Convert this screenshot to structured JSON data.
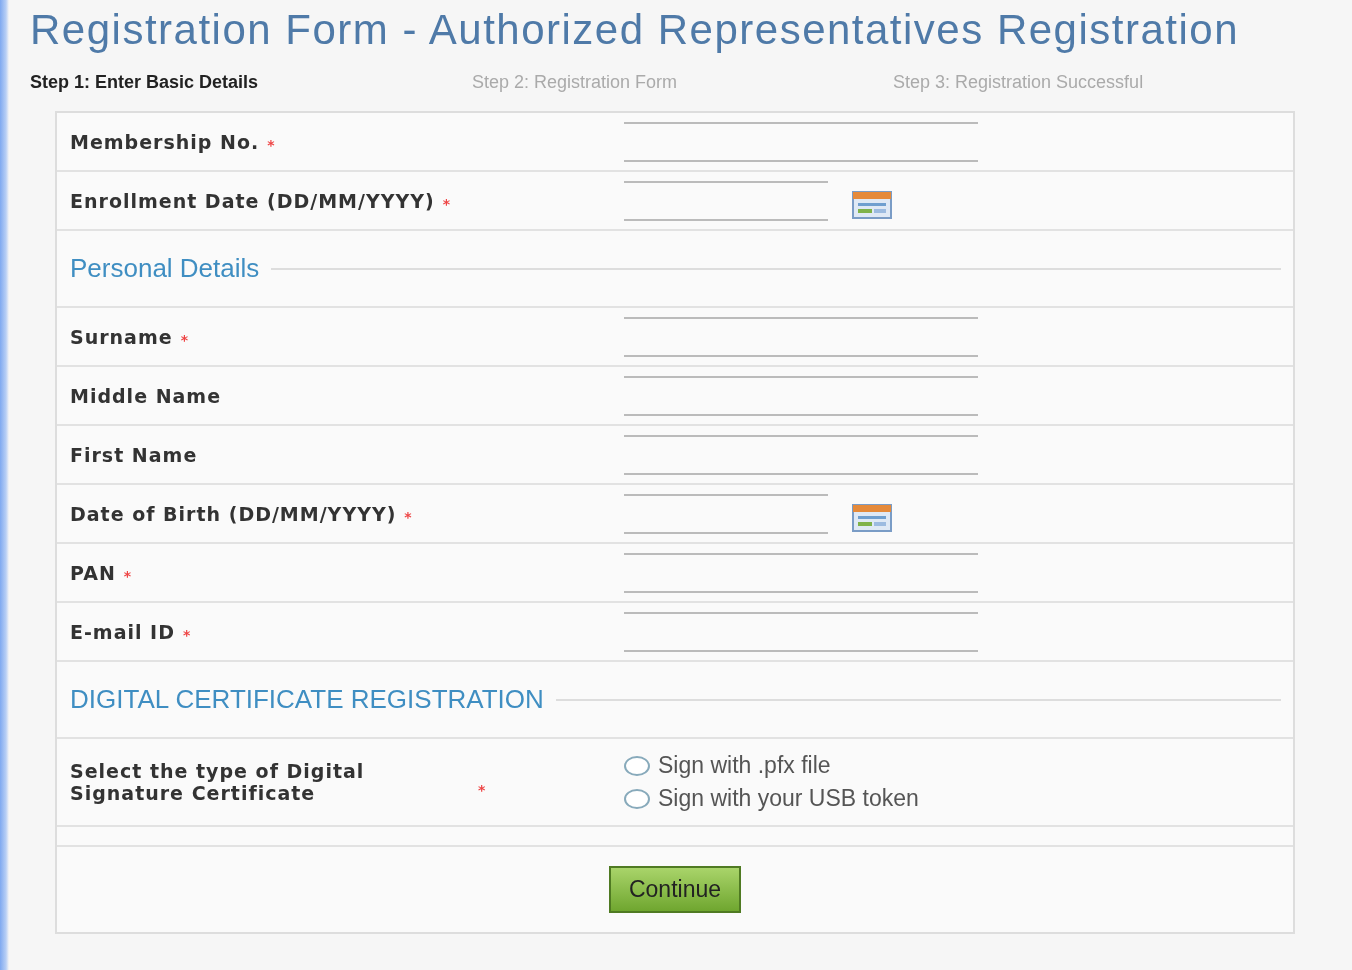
{
  "title": "Registration Form - Authorized Representatives Registration",
  "steps": [
    {
      "label": "Step 1: Enter Basic Details",
      "selected": true
    },
    {
      "label": "Step 2: Registration Form",
      "selected": false
    },
    {
      "label": "Step 3: Registration Successful",
      "selected": false
    }
  ],
  "rows": [
    {
      "kind": "field",
      "label": "Membership No.",
      "mark": "*"
    },
    {
      "kind": "date",
      "label": "Enrollment Date (DD/MM/YYYY)",
      "mark": "*"
    },
    {
      "kind": "section",
      "label": "Personal Details"
    },
    {
      "kind": "field",
      "label": "Surname",
      "mark": "*"
    },
    {
      "kind": "field",
      "label": "Middle Name"
    },
    {
      "kind": "field",
      "label": "First Name"
    },
    {
      "kind": "date",
      "label": "Date of Birth (DD/MM/YYYY)",
      "mark": "*"
    },
    {
      "kind": "field",
      "label": "PAN",
      "mark": "*"
    },
    {
      "kind": "field",
      "label": "E-mail ID",
      "mark": "*"
    },
    {
      "kind": "section",
      "label": "DIGITAL CERTIFICATE REGISTRATION"
    },
    {
      "kind": "radio",
      "label": "Select the type of Digital Signature Certificate",
      "mark": "*",
      "options": [
        {
          "label": "Sign with .pfx file",
          "selected": false
        },
        {
          "label": "Sign with your USB token",
          "selected": false
        }
      ]
    }
  ],
  "button": "Continue"
}
